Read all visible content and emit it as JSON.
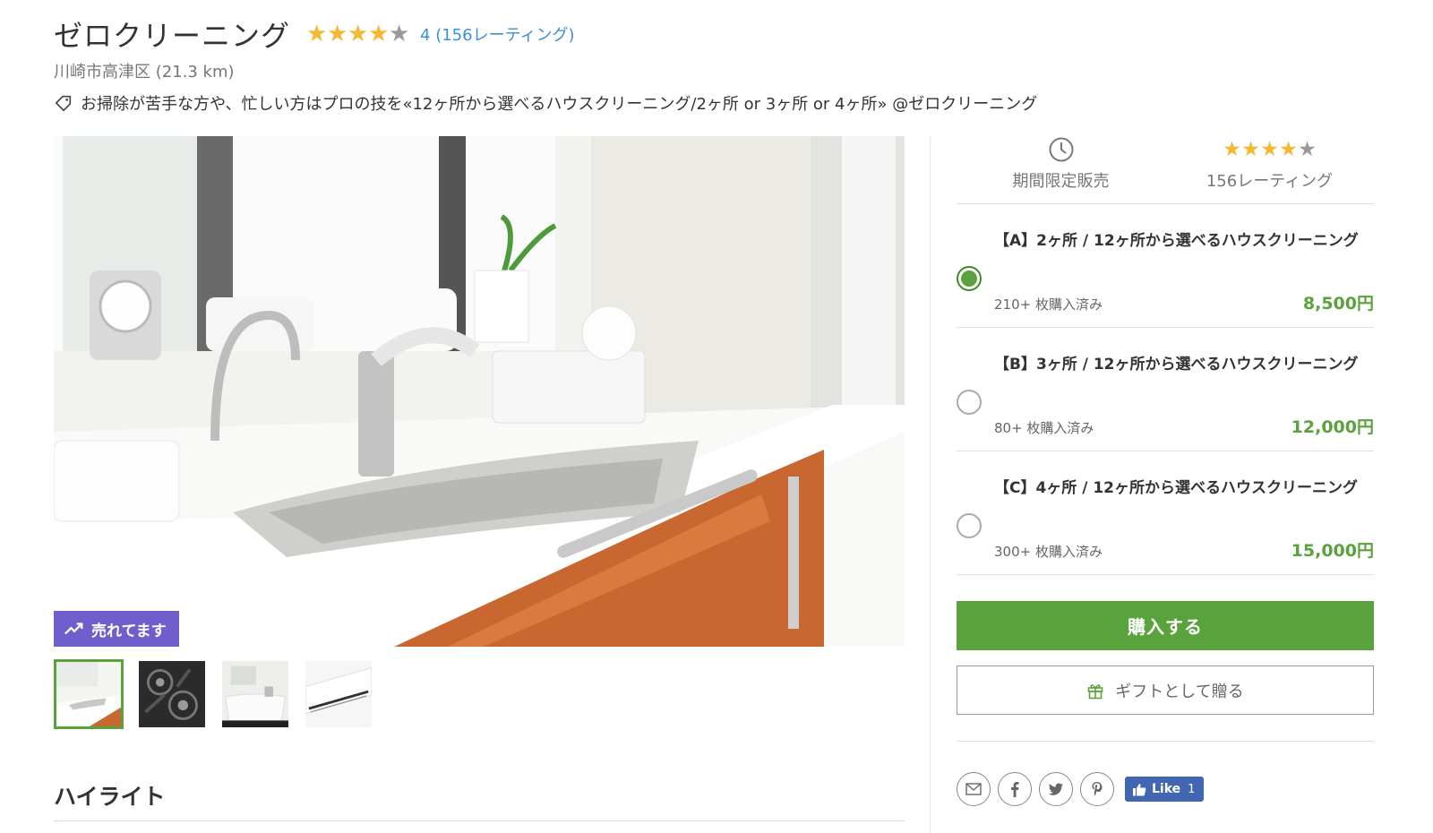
{
  "deal": {
    "title": "ゼロクリーニング",
    "rating_text": "4 (156レーティング)",
    "location": "川崎市高津区 (21.3 km)",
    "tagline": "お掃除が苦手な方や、忙しい方はプロの技を«12ヶ所から選べるハウスクリーニング/2ヶ所 or 3ヶ所 or 4ヶ所» @ゼロクリーニング",
    "rating_stars": 4,
    "rating_max": 5
  },
  "gallery": {
    "badge": "売れてます",
    "thumbnails": [
      "kitchen-sink",
      "gas-stove",
      "bathtub",
      "air-conditioner"
    ],
    "active_index": 0
  },
  "highlights": {
    "title": "ハイライト"
  },
  "sidebar": {
    "stats": [
      {
        "icon": "clock-icon",
        "label": "期間限定販売"
      },
      {
        "icon": "stars",
        "label": "156レーティング"
      }
    ],
    "options": [
      {
        "name": "【A】2ヶ所 / 12ヶ所から選べるハウスクリーニング",
        "sold": "210+ 枚購入済み",
        "price": "8,500円",
        "selected": true
      },
      {
        "name": "【B】3ヶ所 / 12ヶ所から選べるハウスクリーニング",
        "sold": "80+ 枚購入済み",
        "price": "12,000円",
        "selected": false
      },
      {
        "name": "【C】4ヶ所 / 12ヶ所から選べるハウスクリーニング",
        "sold": "300+ 枚購入済み",
        "price": "15,000円",
        "selected": false
      }
    ],
    "buy_label": "購入する",
    "gift_label": "ギフトとして贈る",
    "share": {
      "buttons": [
        "email-icon",
        "facebook-icon",
        "twitter-icon",
        "pinterest-icon"
      ],
      "like_label": "Like",
      "like_count": "1"
    }
  },
  "colors": {
    "accent_green": "#5aa23c",
    "badge_purple": "#6f5fcc",
    "link_blue": "#3b8fd6",
    "star_gold": "#f5b832",
    "facebook_blue": "#4267b2"
  }
}
